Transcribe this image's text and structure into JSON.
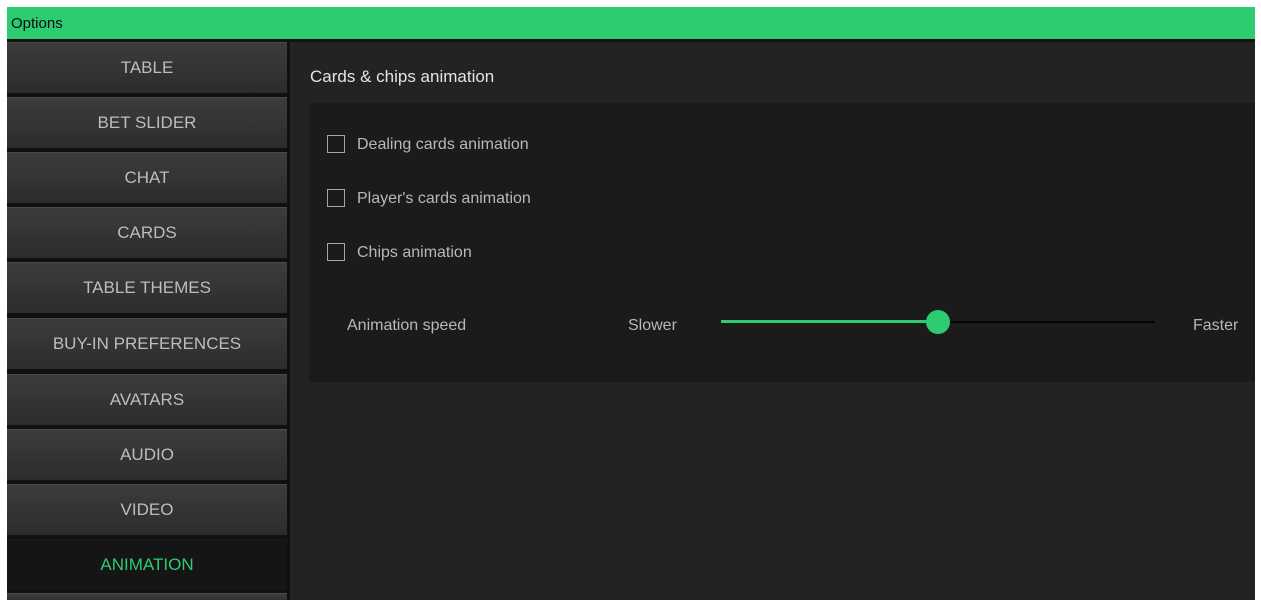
{
  "window": {
    "title": "Options"
  },
  "sidebar": {
    "items": [
      {
        "label": "TABLE",
        "active": false
      },
      {
        "label": "BET SLIDER",
        "active": false
      },
      {
        "label": "CHAT",
        "active": false
      },
      {
        "label": "CARDS",
        "active": false
      },
      {
        "label": "TABLE THEMES",
        "active": false
      },
      {
        "label": "BUY-IN PREFERENCES",
        "active": false
      },
      {
        "label": "AVATARS",
        "active": false
      },
      {
        "label": "AUDIO",
        "active": false
      },
      {
        "label": "VIDEO",
        "active": false
      },
      {
        "label": "ANIMATION",
        "active": true
      },
      {
        "label": "",
        "active": false
      }
    ]
  },
  "content": {
    "section_title": "Cards & chips animation",
    "options": [
      {
        "label": "Dealing cards animation",
        "checked": false
      },
      {
        "label": "Player's cards animation",
        "checked": false
      },
      {
        "label": "Chips animation",
        "checked": false
      }
    ],
    "speed": {
      "label": "Animation speed",
      "min_label": "Slower",
      "max_label": "Faster",
      "value": 0.5
    }
  },
  "colors": {
    "accent": "#2ecc71",
    "title_bar": "#2ecc71",
    "active_nav_text": "#2ecc71",
    "nav_text": "#bdbdbd",
    "content_bg": "#232323",
    "panel_bg": "#1b1b1b"
  }
}
